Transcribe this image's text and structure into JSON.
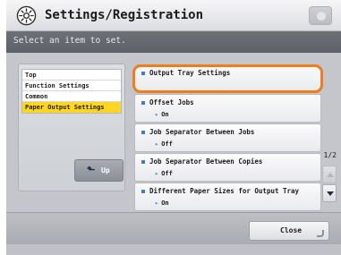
{
  "header": {
    "title": "Settings/Registration",
    "title_icon": "settings-gear-icon",
    "message": "Select an item to set."
  },
  "nav": {
    "items": [
      {
        "label": "Top"
      },
      {
        "label": "Function Settings"
      },
      {
        "label": "Common"
      },
      {
        "label": "Paper Output Settings",
        "active": true
      }
    ],
    "up_label": "Up",
    "up_icon": "return-arrow-icon"
  },
  "list": {
    "items": [
      {
        "title": "Output Tray Settings",
        "value": ""
      },
      {
        "title": "Offset Jobs",
        "value": "On"
      },
      {
        "title": "Job Separator Between Jobs",
        "value": "Off"
      },
      {
        "title": "Job Separator Between Copies",
        "value": "Off"
      },
      {
        "title": "Different Paper Sizes for Output Tray",
        "value": "On"
      }
    ]
  },
  "paging": {
    "page": "1/2"
  },
  "footer": {
    "close_label": "Close"
  },
  "colors": {
    "highlight": "#ee7d1a",
    "active_nav": "#ffd61f",
    "bullet": "#3f7fc6"
  }
}
